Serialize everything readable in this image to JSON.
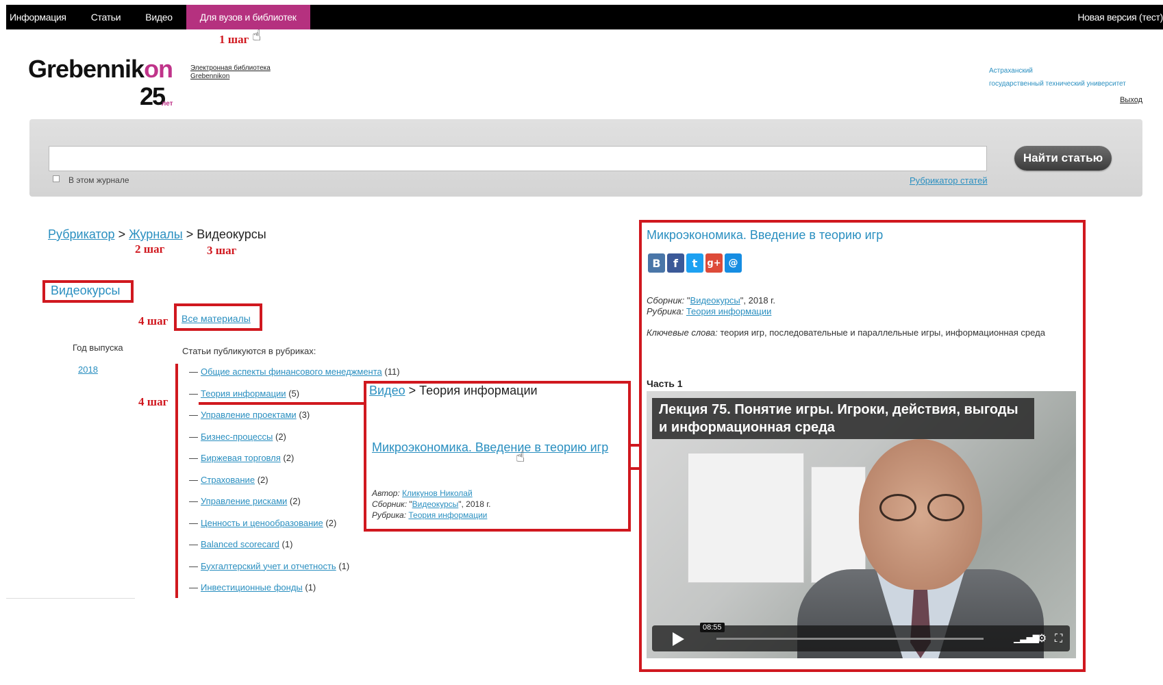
{
  "topnav": {
    "items": [
      "Информация",
      "Статьи",
      "Видео",
      "Для вузов и библиотек"
    ],
    "right": "Новая версия (тест)"
  },
  "steps": {
    "s1": "1 шаг",
    "s2": "2 шаг",
    "s3": "3 шаг",
    "s4a": "4 шаг",
    "s4b": "4 шаг"
  },
  "logo": {
    "text_main": "Grebennik",
    "text_accent": "on",
    "number": "25",
    "suffix": "лет",
    "lib_link_line1": "Электронная библиотека",
    "lib_link_line2": "Grebennikon"
  },
  "user": {
    "univ_line1": "Астраханский",
    "univ_line2": "государственный технический университет",
    "logout": "Выход"
  },
  "search": {
    "placeholder": "",
    "checkbox_label": "В этом журнале",
    "rubricator_link": "Рубрикатор статей",
    "button": "Найти статью"
  },
  "breadcrumb": {
    "rubricator": "Рубрикатор",
    "journals": "Журналы",
    "sep": ">",
    "current": "Видеокурсы"
  },
  "section": {
    "title": "Видеокурсы",
    "all_materials": "Все материалы",
    "year_label": "Год выпуска",
    "year_value": "2018",
    "rubrics_head": "Статьи публикуются в рубриках:",
    "rubrics": [
      {
        "label": "Общие аспекты финансового менеджмента",
        "count": "(11)"
      },
      {
        "label": "Теория информации",
        "count": "(5)"
      },
      {
        "label": "Управление проектами",
        "count": "(3)"
      },
      {
        "label": "Бизнес-процессы",
        "count": "(2)"
      },
      {
        "label": "Биржевая торговля",
        "count": "(2)"
      },
      {
        "label": "Страхование",
        "count": "(2)"
      },
      {
        "label": "Управление рисками",
        "count": "(2)"
      },
      {
        "label": "Ценность и ценообразование",
        "count": "(2)"
      },
      {
        "label": "Balanced scorecard",
        "count": "(1)"
      },
      {
        "label": "Бухгалтерский учет и отчетность",
        "count": "(1)"
      },
      {
        "label": "Инвестиционные фонды",
        "count": "(1)"
      }
    ]
  },
  "popup": {
    "crumb_link": "Видео",
    "crumb_rest": "> Теория информации",
    "title": "Микроэкономика. Введение в теорию игр",
    "author_label": "Автор:",
    "author": "Кликунов Николай",
    "collection_label": "Сборник:",
    "collection": "Видеокурсы",
    "year": ", 2018 г.",
    "rubric_label": "Рубрика:",
    "rubric": "Теория информации"
  },
  "article": {
    "title": "Микроэкономика. Введение в теорию игр",
    "socials": [
      "B",
      "f",
      "t",
      "g+",
      "@"
    ],
    "collection_label": "Сборник:",
    "collection": "Видеокурсы",
    "year": ", 2018 г.",
    "rubric_label": "Рубрика:",
    "rubric": "Теория информации",
    "keywords_label": "Ключевые слова:",
    "keywords": "теория игр, последовательные и параллельные игры, информационная среда",
    "part": "Часть 1",
    "video_title": "Лекция 75. Понятие игры. Игроки, действия, выгоды и информационная среда",
    "video_time": "08:55"
  },
  "colors": {
    "accent": "#b5317f",
    "link": "#2a8fc0",
    "annotation": "#d0181f"
  }
}
